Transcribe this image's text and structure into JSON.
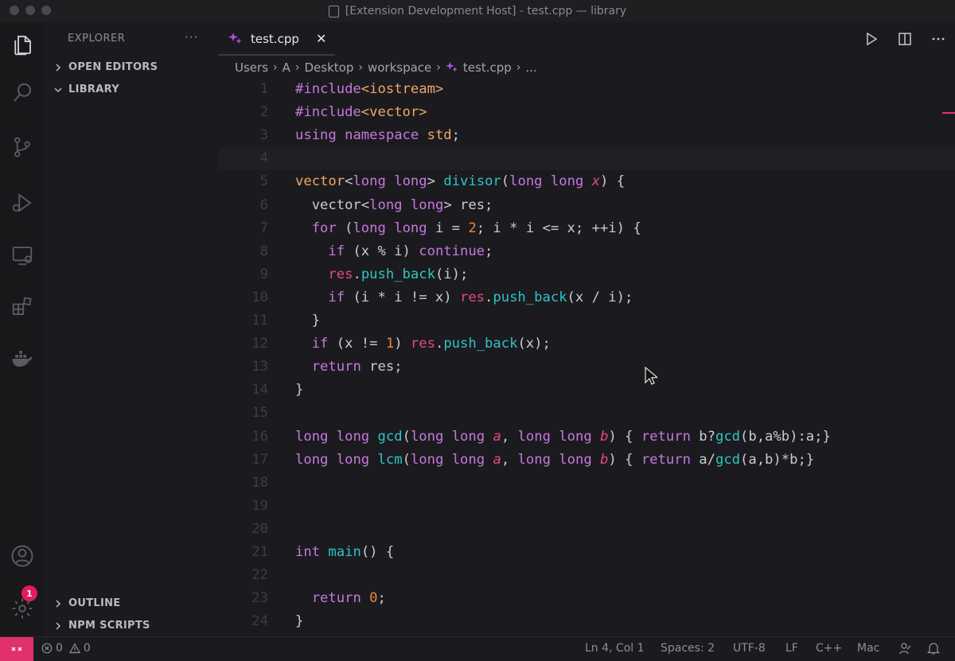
{
  "window": {
    "title": "[Extension Development Host] - test.cpp — library"
  },
  "sidebar": {
    "title": "EXPLORER",
    "more": "···",
    "sections": {
      "open_editors": "OPEN EDITORS",
      "library": "LIBRARY",
      "outline": "OUTLINE",
      "npm_scripts": "NPM SCRIPTS"
    }
  },
  "tab": {
    "label": "test.cpp",
    "close": "✕"
  },
  "breadcrumb": {
    "items": [
      "Users",
      "A",
      "Desktop",
      "workspace",
      "test.cpp",
      "..."
    ]
  },
  "activity": {
    "settings_badge": "1"
  },
  "editor": {
    "lines": [
      {
        "n": "1",
        "tokens": [
          [
            "k",
            "#include"
          ],
          [
            "s",
            "<iostream>"
          ]
        ]
      },
      {
        "n": "2",
        "tokens": [
          [
            "k",
            "#include"
          ],
          [
            "s",
            "<vector>"
          ]
        ]
      },
      {
        "n": "3",
        "tokens": [
          [
            "k",
            "using"
          ],
          [
            "",
            "",
            " "
          ],
          [
            "k",
            "namespace"
          ],
          [
            "",
            "",
            " "
          ],
          [
            "t",
            "std"
          ],
          [
            "",
            ";"
          ]
        ]
      },
      {
        "n": "4",
        "tokens": []
      },
      {
        "n": "5",
        "tokens": [
          [
            "t",
            "vector"
          ],
          [
            "",
            "<"
          ],
          [
            "k",
            "long"
          ],
          [
            "",
            " "
          ],
          [
            "k",
            "long"
          ],
          [
            "",
            "> "
          ],
          [
            "f",
            "divisor"
          ],
          [
            "",
            "("
          ],
          [
            "k",
            "long"
          ],
          [
            "",
            " "
          ],
          [
            "k",
            "long"
          ],
          [
            "",
            " "
          ],
          [
            "p",
            "x"
          ],
          [
            "",
            ") {"
          ]
        ]
      },
      {
        "n": "6",
        "tokens": [
          [
            "",
            "  vector<"
          ],
          [
            "k",
            "long"
          ],
          [
            "",
            " "
          ],
          [
            "k",
            "long"
          ],
          [
            "",
            "> res;"
          ]
        ]
      },
      {
        "n": "7",
        "tokens": [
          [
            "",
            "  "
          ],
          [
            "k",
            "for"
          ],
          [
            "",
            " ("
          ],
          [
            "k",
            "long"
          ],
          [
            "",
            " "
          ],
          [
            "k",
            "long"
          ],
          [
            "",
            " i = "
          ],
          [
            "n",
            "2"
          ],
          [
            "",
            "; i * i <= x; ++i) {"
          ]
        ]
      },
      {
        "n": "8",
        "tokens": [
          [
            "",
            "    "
          ],
          [
            "k",
            "if"
          ],
          [
            "",
            " (x % i) "
          ],
          [
            "k",
            "continue"
          ],
          [
            "",
            ";"
          ]
        ]
      },
      {
        "n": "9",
        "tokens": [
          [
            "",
            "    "
          ],
          [
            "v",
            "res"
          ],
          [
            "",
            "."
          ],
          [
            "f",
            "push_back"
          ],
          [
            "",
            "(i);"
          ]
        ]
      },
      {
        "n": "10",
        "tokens": [
          [
            "",
            "    "
          ],
          [
            "k",
            "if"
          ],
          [
            "",
            " (i * i != x) "
          ],
          [
            "v",
            "res"
          ],
          [
            "",
            "."
          ],
          [
            "f",
            "push_back"
          ],
          [
            "",
            "(x / i);"
          ]
        ]
      },
      {
        "n": "11",
        "tokens": [
          [
            "",
            "  }"
          ]
        ]
      },
      {
        "n": "12",
        "tokens": [
          [
            "",
            "  "
          ],
          [
            "k",
            "if"
          ],
          [
            "",
            " (x != "
          ],
          [
            "n",
            "1"
          ],
          [
            "",
            ") "
          ],
          [
            "v",
            "res"
          ],
          [
            "",
            "."
          ],
          [
            "f",
            "push_back"
          ],
          [
            "",
            "(x);"
          ]
        ]
      },
      {
        "n": "13",
        "tokens": [
          [
            "",
            "  "
          ],
          [
            "k",
            "return"
          ],
          [
            "",
            " res;"
          ]
        ]
      },
      {
        "n": "14",
        "tokens": [
          [
            "",
            "}"
          ]
        ]
      },
      {
        "n": "15",
        "tokens": []
      },
      {
        "n": "16",
        "tokens": [
          [
            "k",
            "long"
          ],
          [
            "",
            " "
          ],
          [
            "k",
            "long"
          ],
          [
            "",
            " "
          ],
          [
            "f",
            "gcd"
          ],
          [
            "",
            "("
          ],
          [
            "k",
            "long"
          ],
          [
            "",
            " "
          ],
          [
            "k",
            "long"
          ],
          [
            "",
            " "
          ],
          [
            "p",
            "a"
          ],
          [
            "",
            ", "
          ],
          [
            "k",
            "long"
          ],
          [
            "",
            " "
          ],
          [
            "k",
            "long"
          ],
          [
            "",
            " "
          ],
          [
            "p",
            "b"
          ],
          [
            "",
            ") { "
          ],
          [
            "k",
            "return"
          ],
          [
            "",
            " b?"
          ],
          [
            "f",
            "gcd"
          ],
          [
            "",
            "(b,a%b):a;}"
          ]
        ]
      },
      {
        "n": "17",
        "tokens": [
          [
            "k",
            "long"
          ],
          [
            "",
            " "
          ],
          [
            "k",
            "long"
          ],
          [
            "",
            " "
          ],
          [
            "f",
            "lcm"
          ],
          [
            "",
            "("
          ],
          [
            "k",
            "long"
          ],
          [
            "",
            " "
          ],
          [
            "k",
            "long"
          ],
          [
            "",
            " "
          ],
          [
            "p",
            "a"
          ],
          [
            "",
            ", "
          ],
          [
            "k",
            "long"
          ],
          [
            "",
            " "
          ],
          [
            "k",
            "long"
          ],
          [
            "",
            " "
          ],
          [
            "p",
            "b"
          ],
          [
            "",
            ") { "
          ],
          [
            "k",
            "return"
          ],
          [
            "",
            " a/"
          ],
          [
            "f",
            "gcd"
          ],
          [
            "",
            "(a,b)*b;}"
          ]
        ]
      },
      {
        "n": "18",
        "tokens": []
      },
      {
        "n": "19",
        "tokens": []
      },
      {
        "n": "20",
        "tokens": []
      },
      {
        "n": "21",
        "tokens": [
          [
            "k",
            "int"
          ],
          [
            "",
            " "
          ],
          [
            "f",
            "main"
          ],
          [
            "",
            "() {"
          ]
        ]
      },
      {
        "n": "22",
        "tokens": []
      },
      {
        "n": "23",
        "tokens": [
          [
            "",
            "  "
          ],
          [
            "k",
            "return"
          ],
          [
            "",
            " "
          ],
          [
            "n",
            "0"
          ],
          [
            "",
            ";"
          ]
        ]
      },
      {
        "n": "24",
        "tokens": [
          [
            "",
            "}"
          ]
        ]
      }
    ]
  },
  "status": {
    "errors": "0",
    "warnings": "0",
    "position": "Ln 4, Col 1",
    "spaces": "Spaces: 2",
    "encoding": "UTF-8",
    "eol": "LF",
    "language": "C++",
    "platform": "Mac"
  },
  "colors": {
    "accent": "#e0316c",
    "keyword": "#c678dd",
    "function": "#2fc4c4",
    "type": "#f0a765"
  }
}
